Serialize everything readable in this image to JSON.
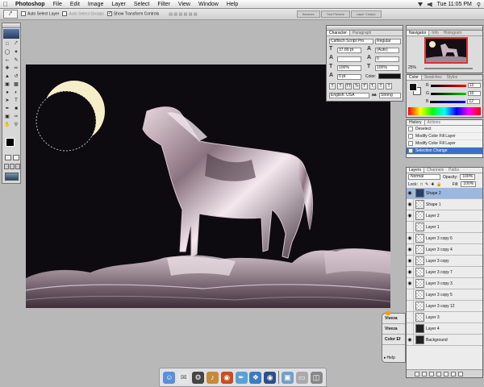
{
  "menubar": {
    "apple": "",
    "app": "Photoshop",
    "items": [
      "File",
      "Edit",
      "Image",
      "Layer",
      "Select",
      "Filter",
      "View",
      "Window",
      "Help"
    ],
    "clock": "Tue 11:05 PM"
  },
  "options": {
    "auto_select_layer": "Auto Select Layer",
    "auto_select_groups": "Auto Select Groups",
    "show_transform_controls": "Show Transform Controls",
    "palette_wells": [
      "Brushes",
      "Tool Presets",
      "Layer Comps"
    ]
  },
  "character": {
    "tabs": [
      "Character",
      "Paragraph"
    ],
    "font_family": "Caflisch Script Pro",
    "font_style": "Regular",
    "size": "37.89 pt",
    "leading": "(Auto)",
    "kerning": "",
    "tracking": "0",
    "vscale": "100%",
    "hscale": "100%",
    "baseline": "0 pt",
    "color_label": "Color:",
    "style_buttons": [
      "T",
      "T",
      "TT",
      "Tr",
      "T'",
      "T,",
      "T",
      "T"
    ],
    "language": "English: USA",
    "antialias": "Strong",
    "color": "#111111"
  },
  "navigator": {
    "tabs": [
      "Navigator",
      "Info",
      "Histogram"
    ],
    "zoom": "25%"
  },
  "color_panel": {
    "tabs": [
      "Color",
      "Swatches",
      "Styles"
    ],
    "r": "13",
    "g": "10",
    "b": "12"
  },
  "history": {
    "tabs": [
      "History",
      "Actions"
    ],
    "items": [
      {
        "name": "Deselect",
        "selected": false
      },
      {
        "name": "Modify Color Fill Layer",
        "selected": false
      },
      {
        "name": "Modify Color Fill Layer",
        "selected": false
      },
      {
        "name": "Selection Change",
        "selected": true
      }
    ]
  },
  "layers": {
    "tabs": [
      "Layers",
      "Channels",
      "Paths"
    ],
    "blend": "Normal",
    "opacity_label": "Opacity:",
    "opacity": "100%",
    "lock_label": "Lock:",
    "fill_label": "Fill:",
    "fill": "100%",
    "items": [
      {
        "name": "Shape 2",
        "eye": true,
        "thumb": "blue",
        "selected": true
      },
      {
        "name": "Shape 1",
        "eye": true,
        "thumb": "check",
        "selected": false
      },
      {
        "name": "Layer 2",
        "eye": true,
        "thumb": "check",
        "selected": false
      },
      {
        "name": "Layer 1",
        "eye": false,
        "thumb": "check",
        "selected": false
      },
      {
        "name": "Layer 3 copy 6",
        "eye": true,
        "thumb": "check",
        "selected": false
      },
      {
        "name": "Layer 3 copy 4",
        "eye": true,
        "thumb": "check",
        "selected": false
      },
      {
        "name": "Layer 3 copy",
        "eye": true,
        "thumb": "check",
        "selected": false
      },
      {
        "name": "Layer 3 copy 7",
        "eye": true,
        "thumb": "check",
        "selected": false
      },
      {
        "name": "Layer 3 copy 3",
        "eye": true,
        "thumb": "check",
        "selected": false
      },
      {
        "name": "Layer 3 copy 5",
        "eye": false,
        "thumb": "check",
        "selected": false
      },
      {
        "name": "Layer 3 copy 12",
        "eye": false,
        "thumb": "check",
        "selected": false
      },
      {
        "name": "Layer 3",
        "eye": false,
        "thumb": "check",
        "selected": false
      },
      {
        "name": "Layer 4",
        "eye": false,
        "thumb": "dark",
        "selected": false
      },
      {
        "name": "Background",
        "eye": true,
        "thumb": "dark",
        "selected": false
      }
    ]
  },
  "viveza": {
    "items": [
      "Viveza",
      "Viveza",
      "Color Ef"
    ],
    "help": "Help"
  }
}
